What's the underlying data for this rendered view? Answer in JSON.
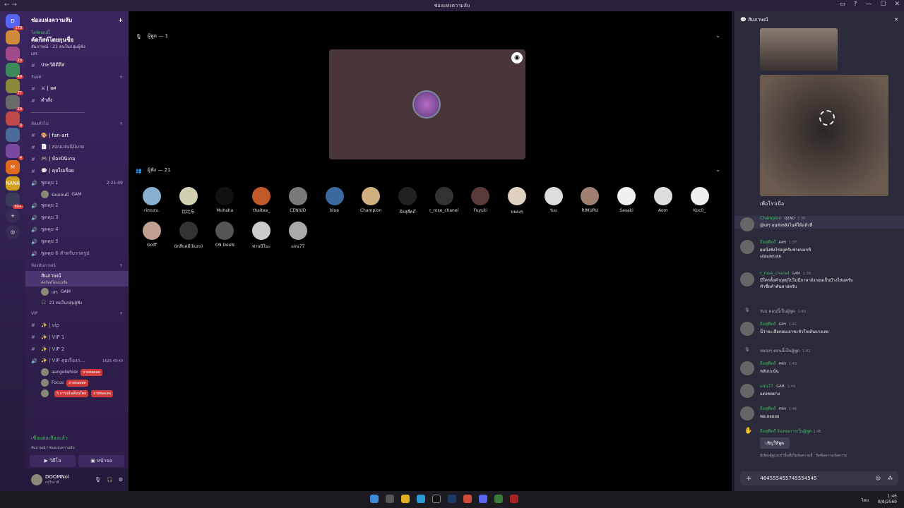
{
  "window": {
    "title": "ช่องแห่งความลับ"
  },
  "servers": [
    {
      "label": "D",
      "badge": "170",
      "color": "#5865f2"
    },
    {
      "label": "",
      "badge": "",
      "color": "#d08a3a"
    },
    {
      "label": "",
      "badge": "20",
      "color": "#a04a8a"
    },
    {
      "label": "",
      "badge": "49",
      "color": "#3a8a5a"
    },
    {
      "label": "",
      "badge": "77",
      "color": "#8a8a3a"
    },
    {
      "label": "",
      "badge": "20",
      "color": "#6a6a6a"
    },
    {
      "label": "",
      "badge": "9",
      "color": "#c04a4a"
    },
    {
      "label": "",
      "badge": "",
      "color": "#4a6a9a"
    },
    {
      "label": "",
      "badge": "4",
      "color": "#7a4aa0"
    },
    {
      "label": "M",
      "badge": "",
      "color": "#e06a20"
    },
    {
      "label": "NANA",
      "badge": "",
      "color": "#d0a020"
    },
    {
      "label": "",
      "badge": "99+",
      "color": "#3a3a5a"
    }
  ],
  "guild": {
    "name": "ช่องแห่งความลับ"
  },
  "event": {
    "status": "ไลฟ์ตอนนี้",
    "title": "คัดกีสต์โดยกุนชื่อ",
    "line1": "สัมภาษณ์ · 21 คนในกลุ่มผู้ฟัง",
    "line2": "เสร"
  },
  "channels_top": [
    {
      "name": "ประวัติดีลีส"
    }
  ],
  "cat_rules": "รับยศ",
  "rules_items": [
    "⚔ | ยศ",
    "คำสั่ง"
  ],
  "divider": "-----------------------------------",
  "cat_chat": "ห้องทั่วไป",
  "chat_items": [
    "🎨 | fan-art",
    "📄 | สอนเล่นนินิเกม",
    "🎮 | ห้องนินิเกม",
    "💬 | คุยไปเรื่อย"
  ],
  "voice": [
    {
      "name": "พูดคุย 1",
      "time": "2:21:09"
    },
    {
      "name": "พูดคุย 2"
    },
    {
      "name": "พูดคุย 3"
    },
    {
      "name": "พูดคุย 4"
    },
    {
      "name": "พูดคุย 5"
    },
    {
      "name": "พูดคุย 6 สำหรับวาดรูป"
    }
  ],
  "voice1_user": {
    "name": "น้องเจนนี่",
    "tag": "GAM"
  },
  "cat_stage": "ห้องสัมภาษณ์",
  "stage": {
    "name": "สัมภาษณ์",
    "topic": "คัดกีสต์โดยกุนชื่อ",
    "user": "เสร",
    "user_tag": "GAM",
    "listeners": "21 คนในกลุ่มผู้ฟัง"
  },
  "cat_vip": "VIP",
  "vip": [
    "✨ | vip",
    "✨ | VIP 1",
    "✨ | VIP 2",
    "✨ | VIP คุยเรื่องก..."
  ],
  "vip_time": "1625:45:40",
  "vip_users": [
    {
      "name": "aangelwhisk",
      "tag": "ถ่ายทอดสด"
    },
    {
      "name": "Focus",
      "tag": "ถ่ายทอดสด"
    },
    {
      "name": "",
      "tag": "ถ่ายทอดสด"
    }
  ],
  "vip_notice": "5 การแจ้งเตือนใหม่",
  "voice_conn": {
    "status": "เชื่อมต่อเสียงแล้ว",
    "where": "สัมภาษณ์ / ช่องแห่งความลับ",
    "video": "วิดีโอ",
    "screen": "หน้าจอ"
  },
  "me": {
    "name": "DOOMNol",
    "status": "อยู่ในเวที"
  },
  "speakers_title": "ผู้พูด — 1",
  "audience_title": "ผู้ฟัง — 21",
  "audience": [
    {
      "name": "rimuru.",
      "c": "#8ab0d0"
    },
    {
      "name": "比比东",
      "c": "#d0d0b0"
    },
    {
      "name": "Muhaha",
      "c": "#111"
    },
    {
      "name": "thaitea_",
      "c": "#c05a2a"
    },
    {
      "name": "CENIUD",
      "c": "#7a7a7a"
    },
    {
      "name": "blue",
      "c": "#3a6aa0"
    },
    {
      "name": "Champion",
      "c": "#d0b080"
    },
    {
      "name": "ธีอสุคืดถ๊",
      "c": "#222"
    },
    {
      "name": "r_rose_chanel",
      "c": "#333"
    },
    {
      "name": "Fuyuki",
      "c": "#5a3a3a"
    },
    {
      "name": "หยองๆ",
      "c": "#e0d0c0"
    },
    {
      "name": "Yuu",
      "c": "#dcdcdc"
    },
    {
      "name": "RIMURU",
      "c": "#a08070"
    },
    {
      "name": "Sasaki",
      "c": "#f0f0f0"
    },
    {
      "name": "Aom",
      "c": "#ddd"
    },
    {
      "name": "Koc0_",
      "c": "#eee"
    },
    {
      "name": "Golff",
      "c": "#c0a090"
    },
    {
      "name": "นักสืบคดี(kuro)",
      "c": "#333"
    },
    {
      "name": "CN DeeN",
      "c": "#555"
    },
    {
      "name": "ท่านนีโนะ",
      "c": "#ccc"
    },
    {
      "name": "แจน77",
      "c": "#aaa"
    }
  ],
  "panel_title": "สัมภาษณ์",
  "img_caption": "เพื่อโรว่เนื่อ",
  "messages": [
    {
      "name": "Champion",
      "badge": "QZAD",
      "time": "1:36",
      "text": "@เสร ผมส่งหลังไมค์ให้แล้วที่"
    },
    {
      "name": "ธีอสุคืดถ๊",
      "badge": "A4H",
      "time": "1:37",
      "text": "ผมนั่งฟังไรอยู่ครับช่วยบอกที\nเอ่อแดกเลย"
    },
    {
      "name": "r_rose_chanel",
      "badge": "GAM",
      "time": "1:39",
      "text": "มีใครตั้งคำถุยทุไปไม่มีภาษาอังกฤษเป็นบ้างไหมครับ\nทำชื่อคำคันหาอ่ตรับ"
    },
    {
      "sys": "Yuu ตอนนี้เป็นผู้พูด",
      "time": "1:40"
    },
    {
      "name": "ธีอสุคืดถ๊",
      "badge": "A4H",
      "time": "1:41",
      "text": "นี่ว่าจะเลือกผมเอาชะหัวใจเต้นแรงเลย"
    },
    {
      "sys": "หยองๆ ตอนนี้เป็นผู้พูด",
      "time": "1:41"
    },
    {
      "name": "ธีอสุคืดถ๊",
      "badge": "A4H",
      "time": "1:43",
      "text": "หลับปะนั่น"
    },
    {
      "name": "แจน77",
      "badge": "GAM",
      "time": "1:44",
      "text": "แต่งซอย่าง"
    },
    {
      "name": "ธีอสุคืดถ๊",
      "badge": "A4H",
      "time": "1:46",
      "text": "พอเลยยยย"
    }
  ],
  "request": {
    "text": "ธีอสุคืดถ๊ ร้องขอการเป็นผู้พูด",
    "time": "1:46",
    "button": "เชิญให้พูด",
    "hint": "มีเพียงผู้ดูแลเท่านั้นที่เห็นข้อความนี้ · ปิดข้อความข้อความ"
  },
  "input_value": "484555455745554545",
  "clock": {
    "time": "1:46",
    "date": "8/8/2569"
  },
  "taskbar_lang": "ไทย"
}
